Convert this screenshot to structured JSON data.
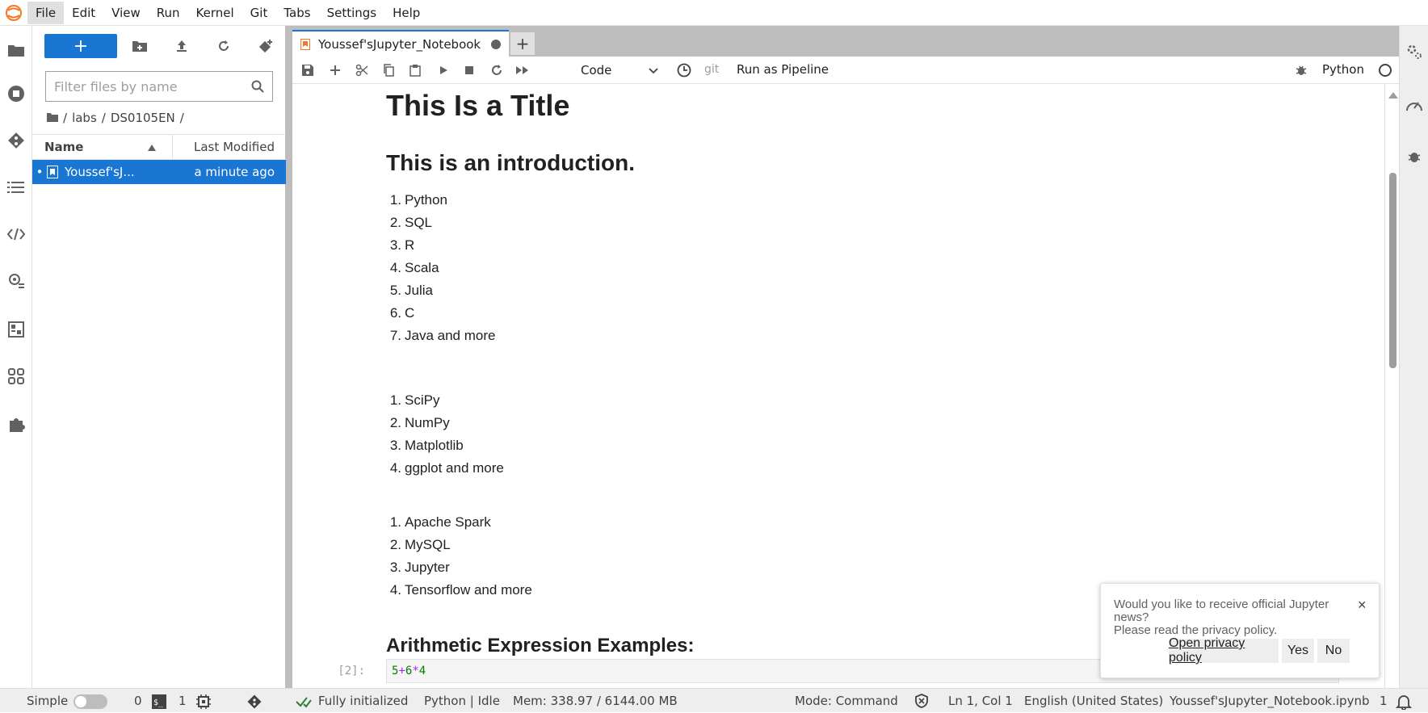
{
  "menu": [
    "File",
    "Edit",
    "View",
    "Run",
    "Kernel",
    "Git",
    "Tabs",
    "Settings",
    "Help"
  ],
  "filebrowser": {
    "new_label": "+",
    "filter_placeholder": "Filter files by name",
    "breadcrumb": [
      "labs",
      "DS0105EN"
    ],
    "col_name": "Name",
    "col_modified": "Last Modified",
    "files": [
      {
        "name": "Youssef'sJ...",
        "modified": "a minute ago"
      }
    ]
  },
  "tab": {
    "label": "Youssef'sJupyter_Notebook",
    "add": "+"
  },
  "toolbar": {
    "cell_type": "Code",
    "git": "git",
    "pipeline": "Run as Pipeline",
    "kernel": "Python"
  },
  "notebook": {
    "title": "This Is a Title",
    "intro": "This is an introduction.",
    "list1": [
      "Python",
      "SQL",
      "R",
      "Scala",
      "Julia",
      "C",
      "Java and more"
    ],
    "list2": [
      "SciPy",
      "NumPy",
      "Matplotlib",
      "ggplot and more"
    ],
    "list3": [
      "Apache Spark",
      "MySQL",
      "Jupyter",
      "Tensorflow and more"
    ],
    "section": "Arithmetic Expression Examples:",
    "cell_prompt": "[2]:",
    "code": {
      "a": "5",
      "op1": "+",
      "b": "6",
      "op2": "*",
      "c": "4"
    }
  },
  "toast": {
    "line1": "Would you like to receive official Jupyter news?",
    "line2": "Please read the privacy policy.",
    "close": "×",
    "privacy": "Open privacy policy",
    "yes": "Yes",
    "no": "No"
  },
  "status": {
    "mode_label": "Simple",
    "terminals": "0",
    "kernels": "1",
    "initialized": "Fully initialized",
    "kernel_state": "Python | Idle",
    "mem": "Mem: 338.97 / 6144.00 MB",
    "command_mode": "Mode: Command",
    "cursor": "Ln 1, Col 1",
    "language": "English (United States)",
    "filename": "Youssef'sJupyter_Notebook.ipynb",
    "notifications": "1"
  },
  "colors": {
    "accent": "#1976d2",
    "tab_icon": "#f37726"
  }
}
